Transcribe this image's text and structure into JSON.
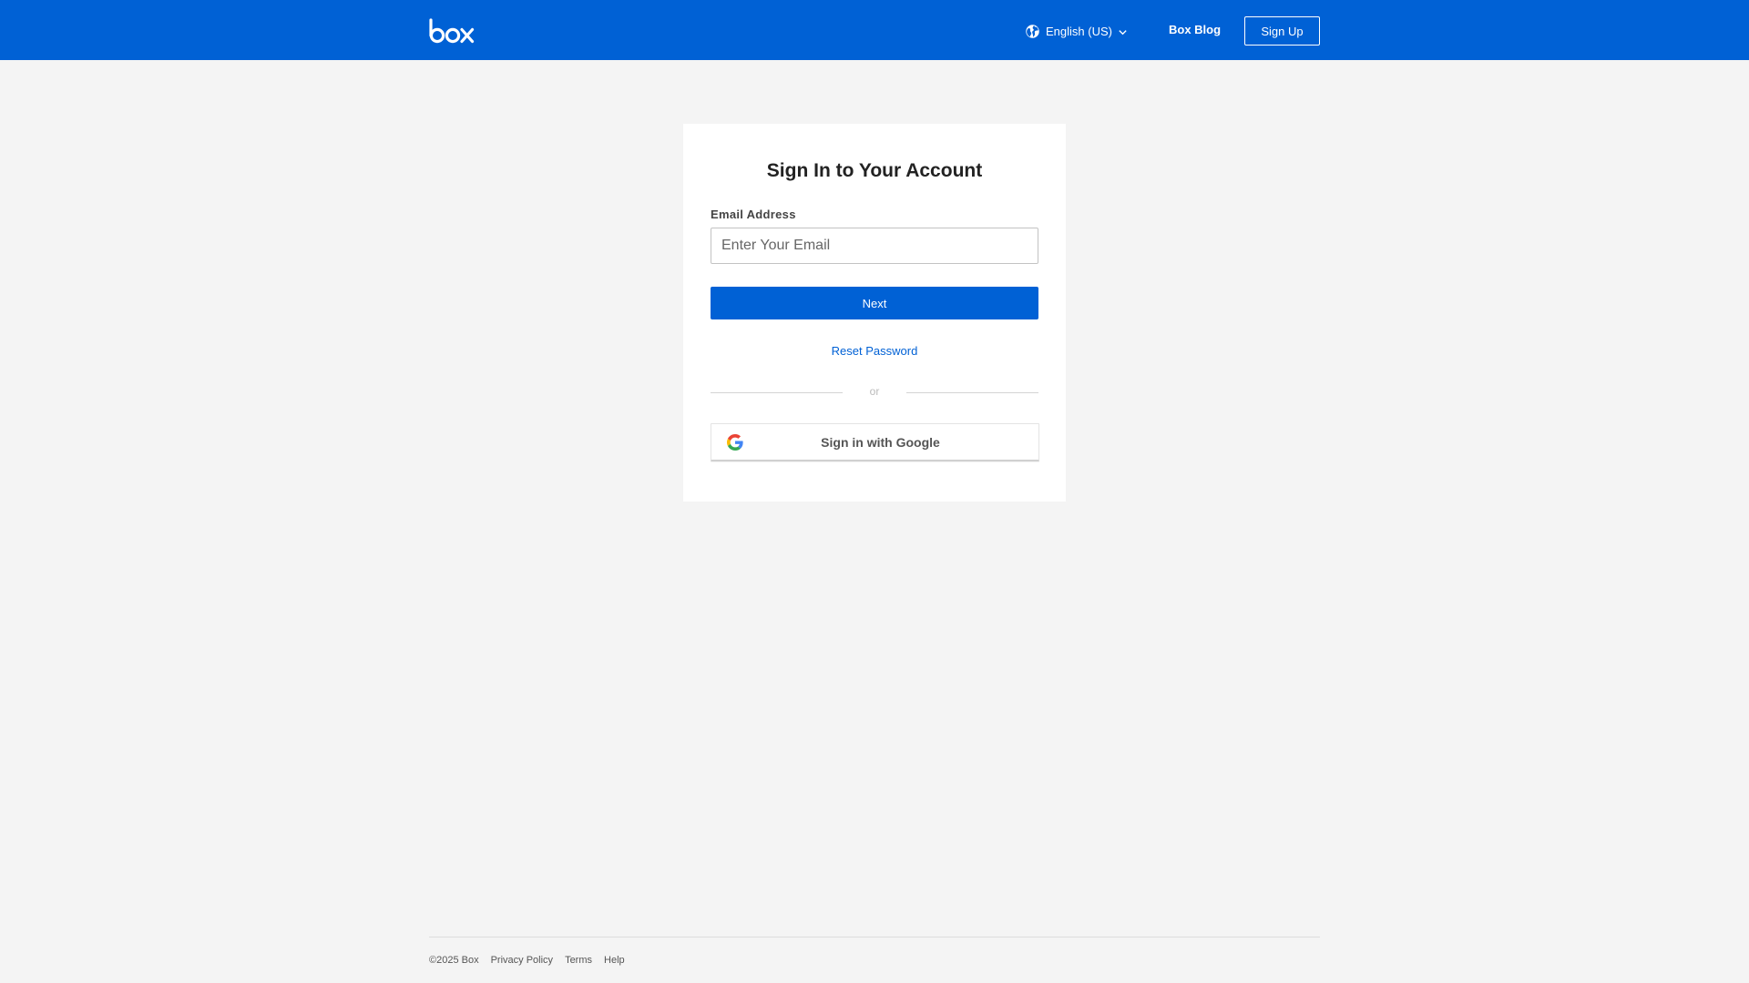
{
  "header": {
    "logo_text": "box",
    "language": "English (US)",
    "blog_link": "Box Blog",
    "signup_button": "Sign Up",
    "brand_color": "#0061d5"
  },
  "login": {
    "title": "Sign In to Your Account",
    "email_label": "Email Address",
    "email_value": "",
    "email_placeholder": "Enter Your Email",
    "next_button": "Next",
    "reset_link": "Reset Password",
    "divider_text": "or",
    "google_button": "Sign in with Google"
  },
  "footer": {
    "copyright": "©2025 Box",
    "links": [
      "Privacy Policy",
      "Terms",
      "Help"
    ]
  }
}
